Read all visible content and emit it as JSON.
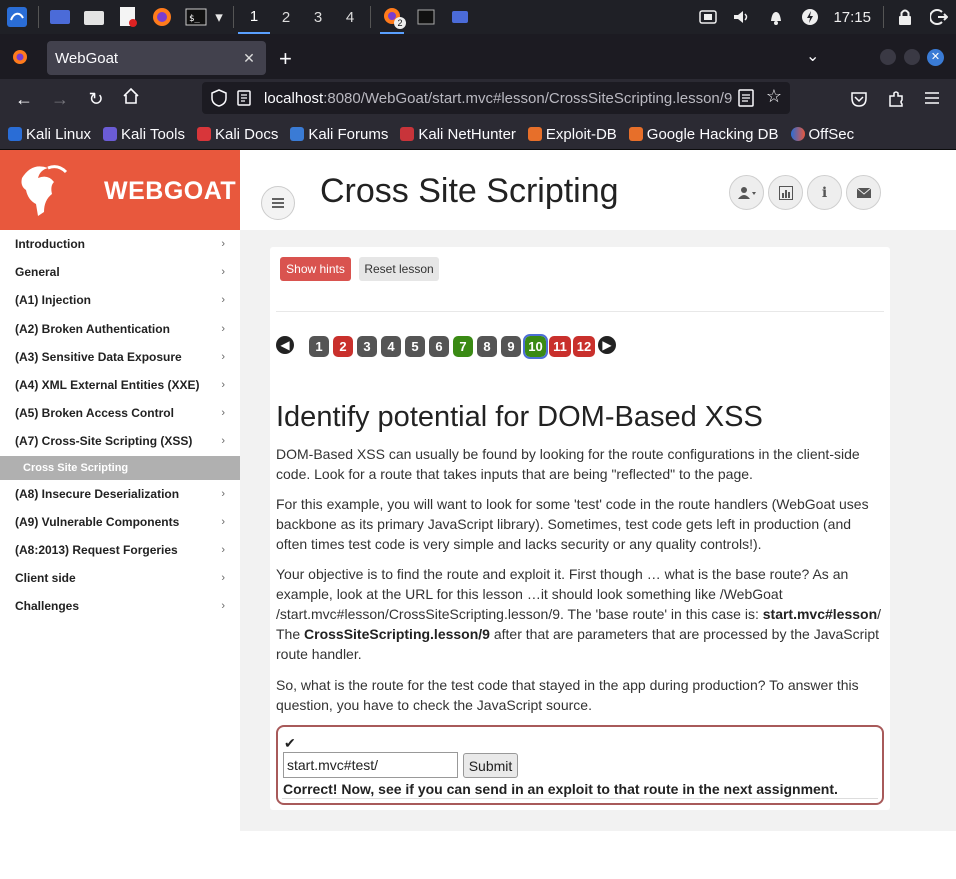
{
  "taskbar": {
    "workspaces": [
      "1",
      "2",
      "3",
      "4"
    ],
    "active_workspace": "1",
    "firefox_badge": "2",
    "clock": "17:15"
  },
  "browser": {
    "tab_title": "WebGoat",
    "url_host": "localhost",
    "url_rest": ":8080/WebGoat/start.mvc#lesson/CrossSiteScripting.lesson/9",
    "bookmarks": [
      "Kali Linux",
      "Kali Tools",
      "Kali Docs",
      "Kali Forums",
      "Kali NetHunter",
      "Exploit-DB",
      "Google Hacking DB",
      "OffSec"
    ]
  },
  "logo": {
    "text": "WEBGOAT"
  },
  "header": {
    "title": "Cross Site Scripting"
  },
  "sidebar": {
    "items": [
      {
        "label": "Introduction"
      },
      {
        "label": "General"
      },
      {
        "label": "(A1) Injection"
      },
      {
        "label": "(A2) Broken Authentication"
      },
      {
        "label": "(A3) Sensitive Data Exposure"
      },
      {
        "label": "(A4) XML External Entities (XXE)"
      },
      {
        "label": "(A5) Broken Access Control"
      },
      {
        "label": "(A7) Cross-Site Scripting (XSS)"
      }
    ],
    "sub_item": "Cross Site Scripting",
    "items_after": [
      {
        "label": "(A8) Insecure Deserialization"
      },
      {
        "label": "(A9) Vulnerable Components"
      },
      {
        "label": "(A8:2013) Request Forgeries"
      },
      {
        "label": "Client side"
      },
      {
        "label": "Challenges"
      }
    ]
  },
  "lesson": {
    "show_hints": "Show hints",
    "reset_lesson": "Reset lesson",
    "pages": [
      {
        "n": "1",
        "state": "gray"
      },
      {
        "n": "2",
        "state": "red"
      },
      {
        "n": "3",
        "state": "gray"
      },
      {
        "n": "4",
        "state": "gray"
      },
      {
        "n": "5",
        "state": "gray"
      },
      {
        "n": "6",
        "state": "gray"
      },
      {
        "n": "7",
        "state": "green"
      },
      {
        "n": "8",
        "state": "gray"
      },
      {
        "n": "9",
        "state": "gray"
      },
      {
        "n": "10",
        "state": "green",
        "selected": true
      },
      {
        "n": "11",
        "state": "red"
      },
      {
        "n": "12",
        "state": "red"
      }
    ],
    "heading": "Identify potential for DOM-Based XSS",
    "p1": "DOM-Based XSS can usually be found by looking for the route configurations in the client-side code. Look for a route that takes inputs that are being \"reflected\" to the page.",
    "p2": "For this example, you will want to look for some 'test' code in the route handlers (WebGoat uses backbone as its primary JavaScript library). Sometimes, test code gets left in production (and often times test code is very simple and lacks security or any quality controls!).",
    "p3_a": "Your objective is to find the route and exploit it. First though … what is the base route? As an example, look at the URL for this lesson …it should look something like /WebGoat /start.mvc#lesson/CrossSiteScripting.lesson/9. The 'base route' in this case is: ",
    "p3_b": "start.mvc#lesson",
    "p3_c": "/ The ",
    "p3_d": "CrossSiteScripting.lesson/9",
    "p3_e": " after that are parameters that are processed by the JavaScript route handler.",
    "p4": "So, what is the route for the test code that stayed in the app during production? To answer this question, you have to check the JavaScript source.",
    "input_value": "start.mvc#test/",
    "submit": "Submit",
    "feedback": "Correct! Now, see if you can send in an exploit to that route in the next assignment."
  },
  "colors": {
    "brand": "#e8583d",
    "hint_red": "#d9534f",
    "page_red": "#c9302c",
    "page_green": "#3a8a14",
    "page_gray": "#555555"
  }
}
